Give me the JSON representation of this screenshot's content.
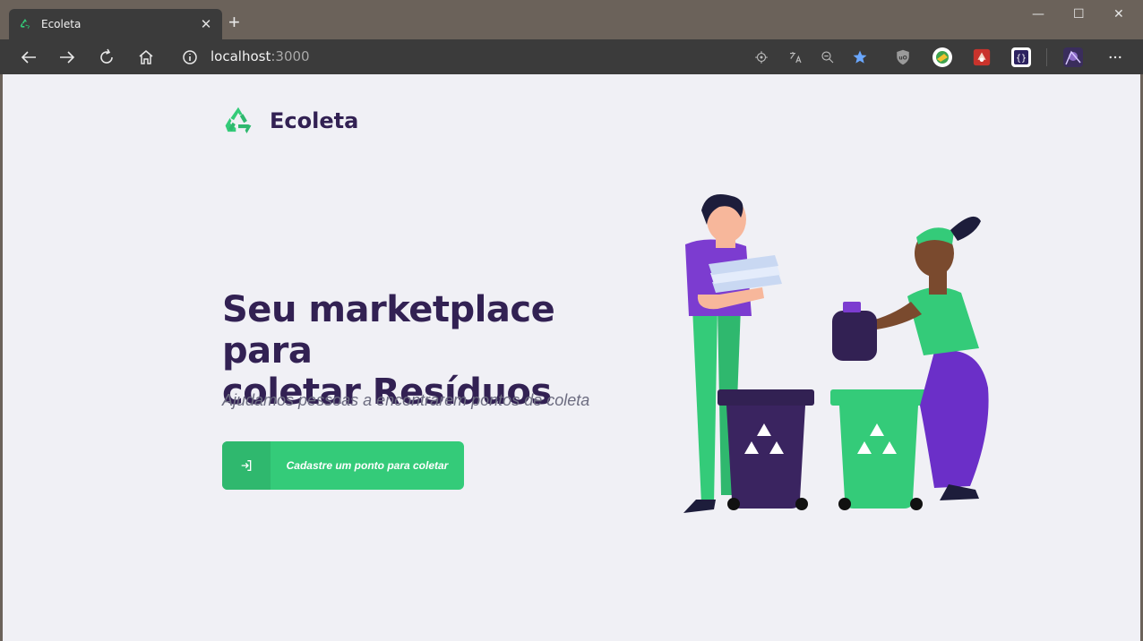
{
  "browser": {
    "tab_title": "Ecoleta",
    "tab_close": "✕",
    "new_tab": "+",
    "url_host": "localhost",
    "url_port": ":3000",
    "window_controls": {
      "minimize": "—",
      "maximize": "☐",
      "close": "✕"
    }
  },
  "page": {
    "logo_text": "Ecoleta",
    "headline_line1": "Seu marketplace para",
    "headline_line2": "coletar Resíduos",
    "subline": "Ajudamos pessoas a encontrarem pontos de coleta",
    "cta_label": "Cadastre um ponto para coletar"
  },
  "colors": {
    "brand_green": "#34cb79",
    "brand_purple": "#322153",
    "text_muted": "#6c6c80",
    "page_bg": "#f0f0f5"
  },
  "icons": {
    "back": "arrow-left-icon",
    "forward": "arrow-right-icon",
    "refresh": "refresh-icon",
    "home": "home-icon",
    "info": "info-icon",
    "cta": "log-in-icon"
  }
}
